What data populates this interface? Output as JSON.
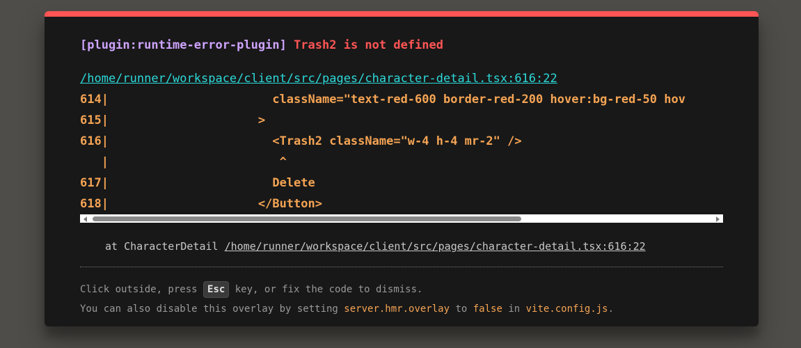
{
  "error": {
    "plugin": "[plugin:runtime-error-plugin]",
    "message": "Trash2 is not defined",
    "file": "/home/runner/workspace/client/src/pages/character-detail.tsx:616:22"
  },
  "frame": {
    "lines": [
      "614|                       className=\"text-red-600 border-red-200 hover:bg-red-50 hov",
      "615|                     >",
      "616|                       <Trash2 className=\"w-4 h-4 mr-2\" />",
      "   |                        ^",
      "617|                       Delete",
      "618|                     </Button>"
    ]
  },
  "stack": {
    "prefix": "at CharacterDetail ",
    "link": "/home/runner/workspace/client/src/pages/character-detail.tsx:616:22"
  },
  "tip": {
    "line1_a": "Click outside, press ",
    "esc_key": "Esc",
    "line1_b": " key, or fix the code to dismiss.",
    "line2_a": "You can also disable this overlay by setting ",
    "config_key": "server.hmr.overlay",
    "line2_b": " to ",
    "false_value": "false",
    "line2_c": " in ",
    "config_file": "vite.config.js",
    "line2_d": "."
  },
  "colors": {
    "accent_top_border": "#ff5555",
    "plugin_text": "#cfa4ff",
    "message_text": "#ff5555",
    "file_link": "#2dd9da",
    "code_text": "#f5a454"
  }
}
